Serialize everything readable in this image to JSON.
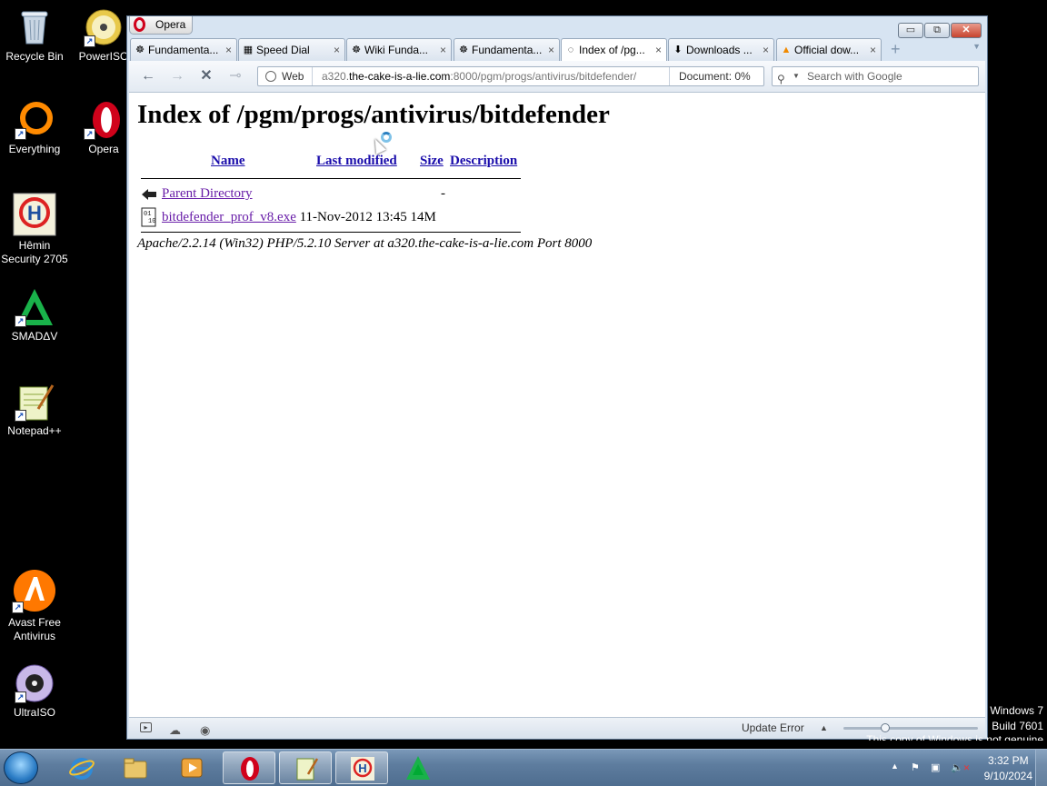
{
  "desktop": {
    "icons": [
      {
        "label": "Recycle Bin",
        "icon": "recycle-bin-icon"
      },
      {
        "label": "PowerISO",
        "icon": "poweriso-icon"
      },
      {
        "label": "Everything",
        "icon": "everything-icon"
      },
      {
        "label": "Opera",
        "icon": "opera-icon"
      },
      {
        "label": "Hêmin Security 2705",
        "icon": "hemin-security-icon"
      },
      {
        "label": "SMADΔV",
        "icon": "smadav-icon"
      },
      {
        "label": "Notepad++",
        "icon": "notepad-plus-plus-icon"
      },
      {
        "label": "Avast Free Antivirus",
        "icon": "avast-icon"
      },
      {
        "label": "UltraISO",
        "icon": "ultraiso-icon"
      }
    ]
  },
  "window": {
    "app_menu_label": "Opera",
    "controls": {
      "minimize": "▭",
      "restore": "⧉",
      "close": "✕"
    },
    "tabs": [
      {
        "label": "Fundamenta...",
        "icon": "opera-page-icon"
      },
      {
        "label": "Speed Dial",
        "icon": "speed-dial-icon"
      },
      {
        "label": "Wiki Funda...",
        "icon": "opera-page-icon"
      },
      {
        "label": "Fundamenta...",
        "icon": "opera-page-icon"
      },
      {
        "label": "Index of /pg...",
        "icon": "loading-spinner-icon",
        "active": true
      },
      {
        "label": "Downloads ...",
        "icon": "downloads-icon"
      },
      {
        "label": "Official dow...",
        "icon": "vlc-icon"
      }
    ],
    "tab_close_glyph": "×",
    "new_tab_glyph": "+",
    "nav": {
      "back": "←",
      "forward": "→",
      "stop": "✕",
      "key": "⊸"
    },
    "address": {
      "badge": "Web",
      "url_prefix": "a320.",
      "url_host": "the-cake-is-a-lie.com",
      "url_path": ":8000/pgm/progs/antivirus/bitdefender/",
      "document_progress": "Document:   0%"
    },
    "search_placeholder": "Search with Google",
    "status": {
      "update": "Update Error",
      "zoom_level": 0.3
    }
  },
  "page": {
    "title": "Index of /pgm/progs/antivirus/bitdefender",
    "columns": {
      "name": "Name",
      "modified": "Last modified",
      "size": "Size",
      "description": "Description"
    },
    "rows": [
      {
        "name": "Parent Directory",
        "modified": "",
        "size": "-",
        "icon": "back-arrow-icon"
      },
      {
        "name": "bitdefender_prof_v8.exe",
        "modified": "11-Nov-2012 13:45",
        "size": "14M",
        "icon": "binary-file-icon"
      }
    ],
    "signature": "Apache/2.2.14 (Win32) PHP/5.2.10 Server at a320.the-cake-is-a-lie.com Port 8000"
  },
  "taskbar": {
    "items": [
      "internet-explorer-icon",
      "file-explorer-icon",
      "media-player-icon",
      "opera-icon",
      "notepad-plus-plus-icon",
      "hemin-security-icon",
      "smadav-icon"
    ],
    "tray": {
      "overflow": "▲",
      "time": "3:32 PM",
      "date": "9/10/2024"
    }
  },
  "watermark": {
    "line1": "Windows 7",
    "line2": "Build 7601",
    "line3": "This copy of Windows is not genuine"
  }
}
